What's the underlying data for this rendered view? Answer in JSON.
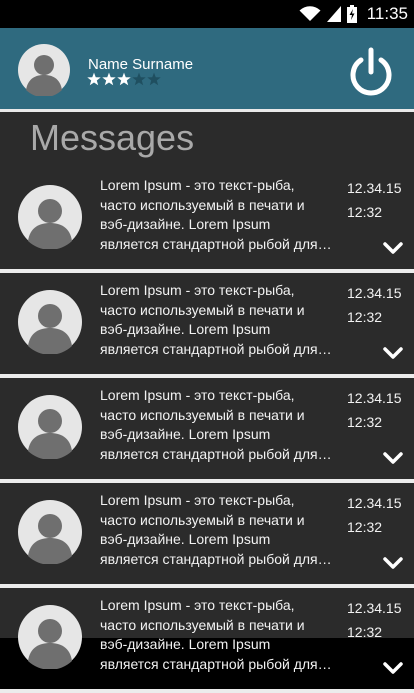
{
  "status_bar": {
    "time": "11:35",
    "icons": [
      "wifi-icon",
      "signal-icon",
      "battery-charging-icon"
    ]
  },
  "profile": {
    "name": "Name Surname",
    "rating": 3,
    "rating_max": 5,
    "colors": {
      "header_bg": "#2f6a7f",
      "star_filled": "#ffffff",
      "star_empty": "#1f4f60"
    }
  },
  "messages_section": {
    "title": "Messages",
    "items": [
      {
        "text": "Lorem Ipsum - это текст-рыба, часто используемый в печати и вэб-дизайне. Lorem Ipsum является стандартной рыбой для текстов на латинице",
        "date": "12.34.15",
        "time": "12:32"
      },
      {
        "text": "Lorem Ipsum - это текст-рыба, часто используемый в печати и вэб-дизайне. Lorem Ipsum является стандартной рыбой для текстов на латинице",
        "date": "12.34.15",
        "time": "12:32"
      },
      {
        "text": "Lorem Ipsum - это текст-рыба, часто используемый в печати и вэб-дизайне. Lorem Ipsum является стандартной рыбой для текстов на латинице",
        "date": "12.34.15",
        "time": "12:32"
      },
      {
        "text": "Lorem Ipsum - это текст-рыба, часто используемый в печати и вэб-дизайне. Lorem Ipsum является стандартной рыбой для текстов на латинице",
        "date": "12.34.15",
        "time": "12:32"
      },
      {
        "text": "Lorem Ipsum - это текст-рыба, часто используемый в печати и вэб-дизайне. Lorem Ipsum является стандартной рыбой для текстов на латинице",
        "date": "12.34.15",
        "time": "12:32"
      }
    ]
  }
}
